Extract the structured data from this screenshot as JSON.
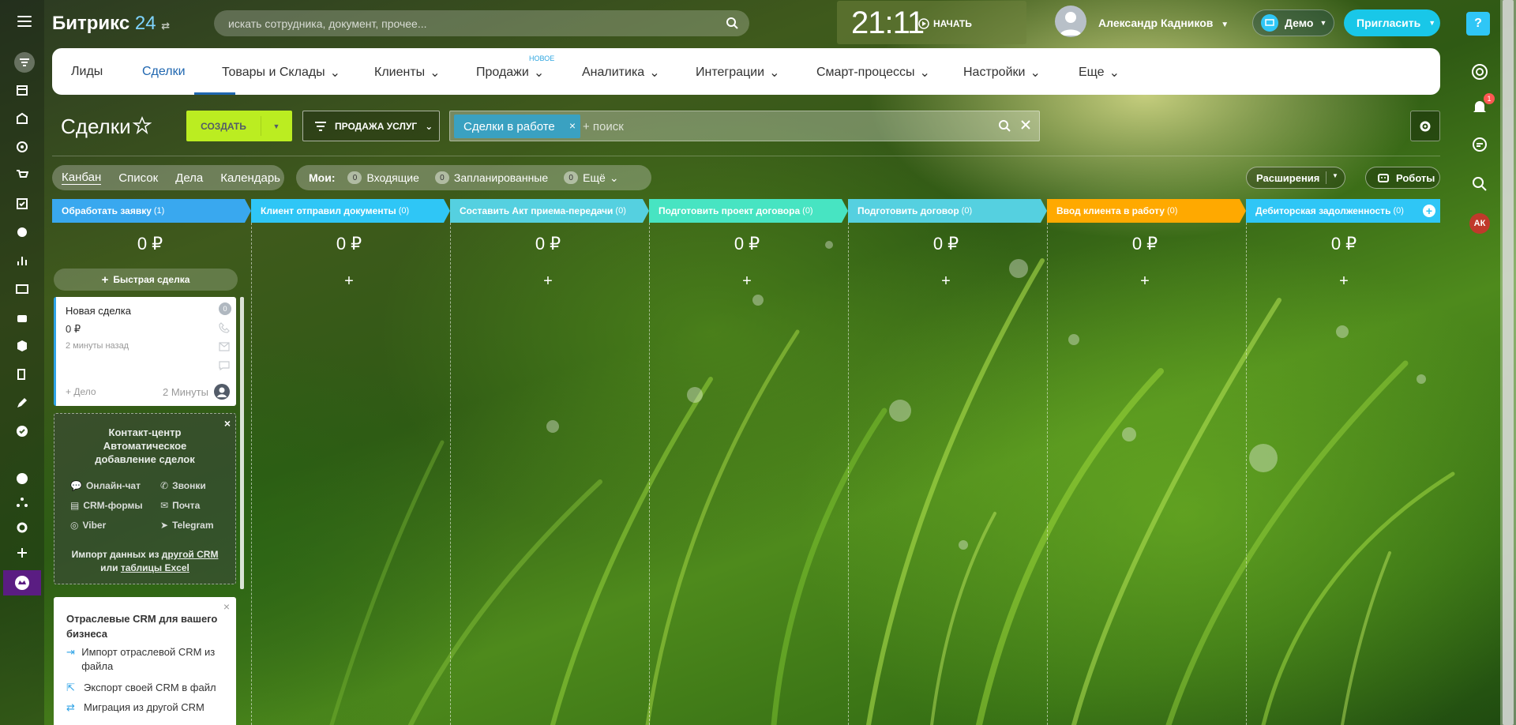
{
  "header": {
    "logo_main": "Битрикс",
    "logo_num": "24",
    "search_placeholder": "искать сотрудника, документ, прочее...",
    "clock": "21:11",
    "start_label": "НАЧАТЬ",
    "user_name": "Александр Кадников",
    "demo_label": "Демо",
    "invite_label": "Пригласить",
    "help_label": "?"
  },
  "nav": {
    "new_tag": "НОВОЕ",
    "items": [
      {
        "label": "Лиды"
      },
      {
        "label": "Сделки"
      },
      {
        "label": "Товары и Склады"
      },
      {
        "label": "Клиенты"
      },
      {
        "label": "Продажи"
      },
      {
        "label": "Аналитика"
      },
      {
        "label": "Интеграции"
      },
      {
        "label": "Смарт-процессы"
      },
      {
        "label": "Настройки"
      },
      {
        "label": "Еще"
      }
    ]
  },
  "toolbar": {
    "page_title": "Сделки",
    "create_label": "СОЗДАТЬ",
    "category_label": "ПРОДАЖА УСЛУГ",
    "filter_tag": "Сделки в работе",
    "filter_placeholder": "+ поиск"
  },
  "views": {
    "items": [
      "Канбан",
      "Список",
      "Дела",
      "Календарь"
    ]
  },
  "mine": {
    "label": "Мои:",
    "groups": [
      {
        "count": "0",
        "label": "Входящие"
      },
      {
        "count": "0",
        "label": "Запланированные"
      },
      {
        "count": "0",
        "label": "Ещё"
      }
    ]
  },
  "actions": {
    "extensions_label": "Расширения",
    "robots_label": "Роботы"
  },
  "kanban": {
    "stages": [
      {
        "name": "Обработать заявку",
        "count": "(1)",
        "sum": "0 ₽",
        "color": "#39a8ef"
      },
      {
        "name": "Клиент отправил документы",
        "count": "(0)",
        "sum": "0 ₽",
        "color": "#2fc6f6"
      },
      {
        "name": "Составить Акт приема-передачи",
        "count": "(0)",
        "sum": "0 ₽",
        "color": "#55d0e0"
      },
      {
        "name": "Подготовить проект договора",
        "count": "(0)",
        "sum": "0 ₽",
        "color": "#47e4c2"
      },
      {
        "name": "Подготовить договор",
        "count": "(0)",
        "sum": "0 ₽",
        "color": "#55d0e0"
      },
      {
        "name": "Ввод клиента в работу",
        "count": "(0)",
        "sum": "0 ₽",
        "color": "#ffa900"
      },
      {
        "name": "Дебиторская задолженность",
        "count": "(0)",
        "sum": "0 ₽",
        "color": "#2fc6f6"
      }
    ],
    "quick_deal_label": "Быстрая сделка",
    "plus": "+"
  },
  "card": {
    "title": "Новая сделка",
    "sum": "0 ₽",
    "time": "2 минуты назад",
    "badge": "0",
    "add_activity": "+ Дело",
    "duration": "2 Минуты"
  },
  "contact_center": {
    "close": "×",
    "title_1": "Контакт-центр",
    "title_2": "Автоматическое добавление сделок",
    "channels": [
      "Онлайн-чат",
      "Звонки",
      "CRM-формы",
      "Почта",
      "Viber",
      "Telegram"
    ],
    "import_1": "Импорт данных из",
    "import_link_1": "другой CRM",
    "import_2": "или",
    "import_link_2": "таблицы Excel"
  },
  "industry": {
    "close": "×",
    "title": "Отраслевые CRM для вашего бизнеса",
    "rows": [
      "Импорт отраслевой CRM из файла",
      "Экспорт своей CRM в файл",
      "Миграция из другой CRM"
    ]
  },
  "right_bar": {
    "notif_count": "1",
    "user_initials": "АК"
  },
  "colors": {
    "accent_blue": "#2067b0",
    "create_green": "#bbed21",
    "invite_cyan": "#19c7e8"
  }
}
